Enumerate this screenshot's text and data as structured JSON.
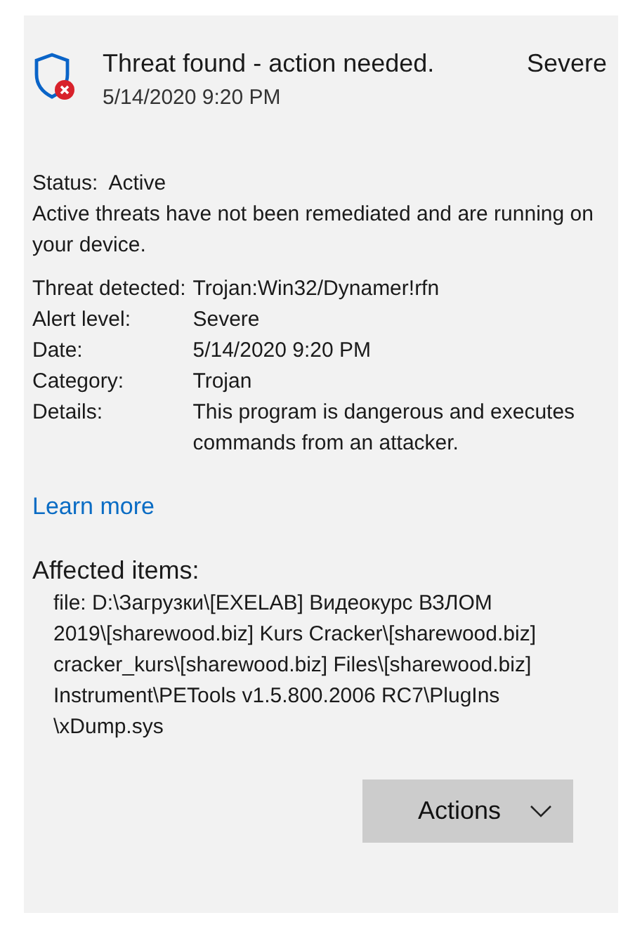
{
  "header": {
    "title": "Threat found - action needed.",
    "severity": "Severe",
    "timestamp": "5/14/2020 9:20 PM"
  },
  "status": {
    "label": "Status:",
    "value": "Active",
    "description": "Active threats have not been remediated and are running on your device."
  },
  "details": [
    {
      "label": "Threat detected:",
      "value": "Trojan:Win32/Dynamer!rfn"
    },
    {
      "label": "Alert level:",
      "value": "Severe"
    },
    {
      "label": "Date:",
      "value": "5/14/2020 9:20 PM"
    },
    {
      "label": "Category:",
      "value": "Trojan"
    },
    {
      "label": "Details:",
      "value": "This program is dangerous and executes commands from an attacker."
    }
  ],
  "learn_more": "Learn more",
  "affected": {
    "heading": "Affected items:",
    "lines": [
      "file: D:\\Загрузки\\[EXELAB] Видеокурс ВЗЛОМ",
      "2019\\[sharewood.biz] Kurs Cracker\\[sharewood.biz]",
      "cracker_kurs\\[sharewood.biz] Files\\[sharewood.biz]",
      "Instrument\\PETools v1.5.800.2006 RC7\\PlugIns",
      "\\xDump.sys"
    ]
  },
  "actions_button": "Actions"
}
